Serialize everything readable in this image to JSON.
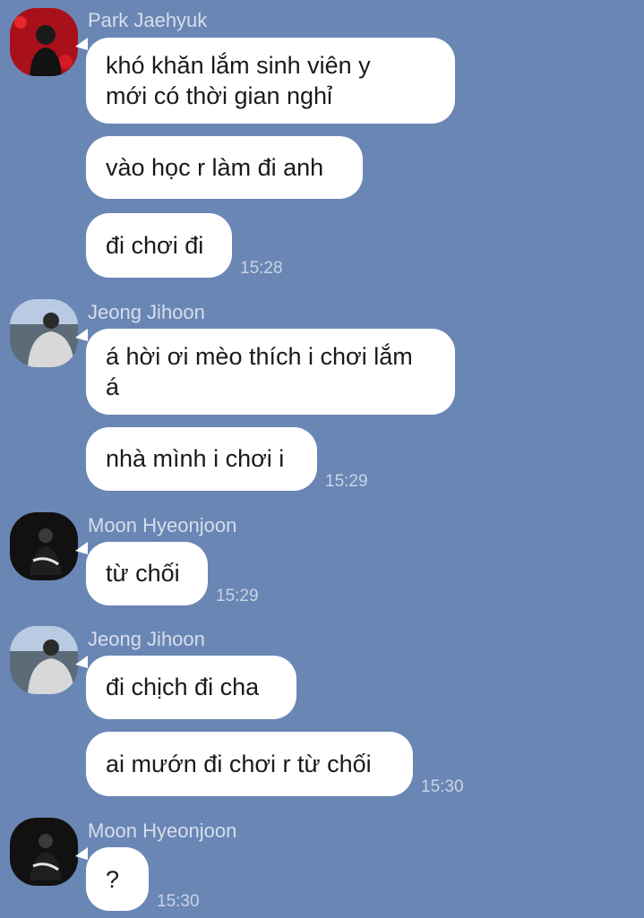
{
  "colors": {
    "background": "#6a86b5",
    "bubble": "#ffffff",
    "name_text": "#d6deea",
    "time_text": "#c9d4e6"
  },
  "groups": [
    {
      "sender": "Park Jaehyuk",
      "avatar": "avatar-red",
      "messages": [
        {
          "lines": [
            "khó khăn lắm sinh viên y",
            "mới có thời gian nghỉ"
          ]
        },
        {
          "lines": [
            "vào học r làm đi anh"
          ]
        },
        {
          "lines": [
            "đi chơi đi"
          ],
          "time": "15:28"
        }
      ]
    },
    {
      "sender": "Jeong Jihoon",
      "avatar": "avatar-photo",
      "messages": [
        {
          "lines": [
            "á hời ơi mèo thích i chơi lắm",
            "á"
          ]
        },
        {
          "lines": [
            "nhà mình i chơi i"
          ],
          "time": "15:29"
        }
      ]
    },
    {
      "sender": "Moon Hyeonjoon",
      "avatar": "avatar-dark",
      "messages": [
        {
          "lines": [
            "từ chối"
          ],
          "time": "15:29"
        }
      ]
    },
    {
      "sender": "Jeong Jihoon",
      "avatar": "avatar-photo",
      "messages": [
        {
          "lines": [
            "đi chịch đi cha"
          ]
        },
        {
          "lines": [
            "ai mướn đi chơi r từ chối"
          ],
          "time": "15:30"
        }
      ]
    },
    {
      "sender": "Moon Hyeonjoon",
      "avatar": "avatar-dark",
      "messages": [
        {
          "lines": [
            "?"
          ],
          "time": "15:30"
        }
      ]
    }
  ]
}
